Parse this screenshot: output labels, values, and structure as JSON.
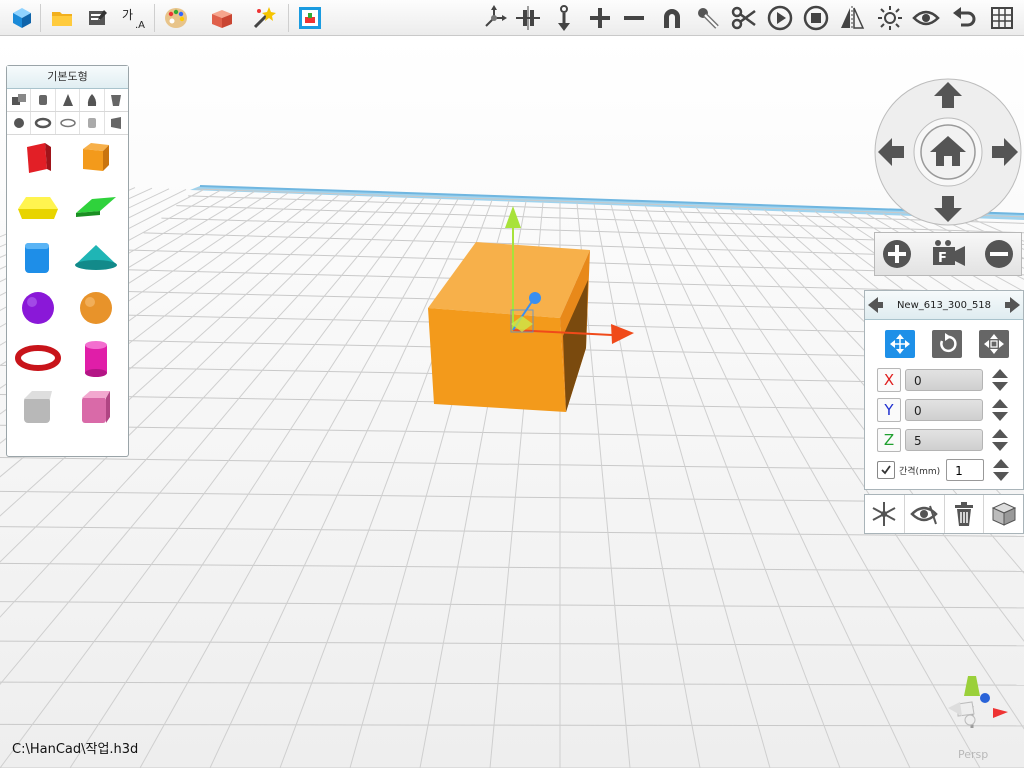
{
  "toolbar": {
    "buttons": [
      "new-model",
      "open-file",
      "save-file",
      "text-tool",
      "color-palette",
      "package",
      "magic-wand",
      "image-export",
      "measure",
      "align",
      "anchor",
      "add",
      "subtract",
      "magnet",
      "brush",
      "cut",
      "play",
      "stop",
      "mirror",
      "lighting",
      "view",
      "undo",
      "grid"
    ]
  },
  "palette": {
    "title": "기본도형"
  },
  "properties": {
    "object_name": "New_613_300_518",
    "x_label": "X",
    "y_label": "Y",
    "z_label": "Z",
    "x_value": "0",
    "y_value": "0",
    "z_value": "5",
    "spacing_label": "간격(mm)",
    "spacing_value": "1",
    "spacing_checked": true
  },
  "colors": {
    "cube": "#f39a1b",
    "axis_x": "#f04a1a",
    "axis_y": "#a8e23a",
    "axis_z": "#3a8ff0",
    "accent": "#1e90e8"
  },
  "status": {
    "file_path": "C:\\HanCad\\작업.h3d",
    "view_mode": "Persp"
  }
}
